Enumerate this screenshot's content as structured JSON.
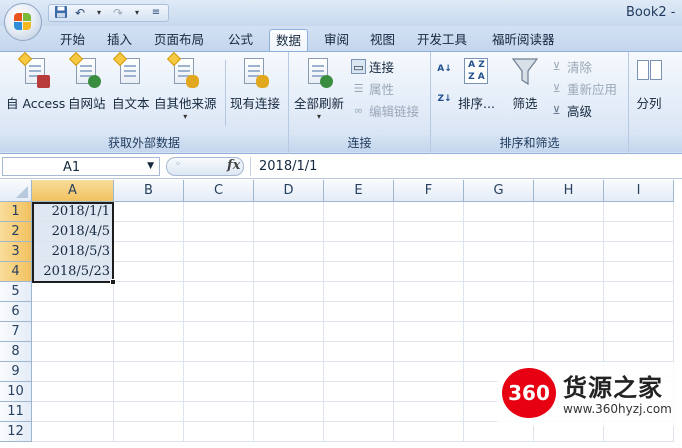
{
  "window": {
    "title": "Book2 - "
  },
  "quick_access": {
    "icons": [
      "save-icon",
      "undo-icon",
      "redo-icon",
      "customize-icon"
    ]
  },
  "tabs": [
    {
      "label": "开始",
      "active": false
    },
    {
      "label": "插入",
      "active": false
    },
    {
      "label": "页面布局",
      "active": false
    },
    {
      "label": "公式",
      "active": false
    },
    {
      "label": "数据",
      "active": true
    },
    {
      "label": "审阅",
      "active": false
    },
    {
      "label": "视图",
      "active": false
    },
    {
      "label": "开发工具",
      "active": false
    },
    {
      "label": "福昕阅读器",
      "active": false
    }
  ],
  "ribbon": {
    "external_data": {
      "label": "获取外部数据",
      "buttons": [
        "自 Access",
        "自网站",
        "自文本",
        "自其他来源",
        "现有连接"
      ]
    },
    "connections": {
      "label": "连接",
      "refresh_all": "全部刷新",
      "connections": "连接",
      "properties": "属性",
      "edit_links": "编辑链接"
    },
    "sort_filter": {
      "label": "排序和筛选",
      "sort": "排序...",
      "filter": "筛选",
      "clear": "清除",
      "reapply": "重新应用",
      "advanced": "高级"
    },
    "data_tools": {
      "split_columns": "分列"
    }
  },
  "formula_bar": {
    "name_box": "A1",
    "fx": "fx",
    "formula": "2018/1/1"
  },
  "sheet": {
    "columns": [
      "A",
      "B",
      "C",
      "D",
      "E",
      "F",
      "G",
      "H",
      "I"
    ],
    "rows": [
      "1",
      "2",
      "3",
      "4",
      "5",
      "6",
      "7",
      "8",
      "9",
      "10",
      "11",
      "12"
    ],
    "cells": {
      "A1": "2018/1/1",
      "A2": "2018/4/5",
      "A3": "2018/5/3",
      "A4": "2018/5/23"
    }
  },
  "watermark": {
    "logo": "360",
    "name": "货源之家",
    "url": "www.360hyzj.com"
  },
  "colors": {
    "selection_header": "#f1c15f",
    "selected_cell": "#dfe7f2",
    "brand_red": "#e60012"
  }
}
